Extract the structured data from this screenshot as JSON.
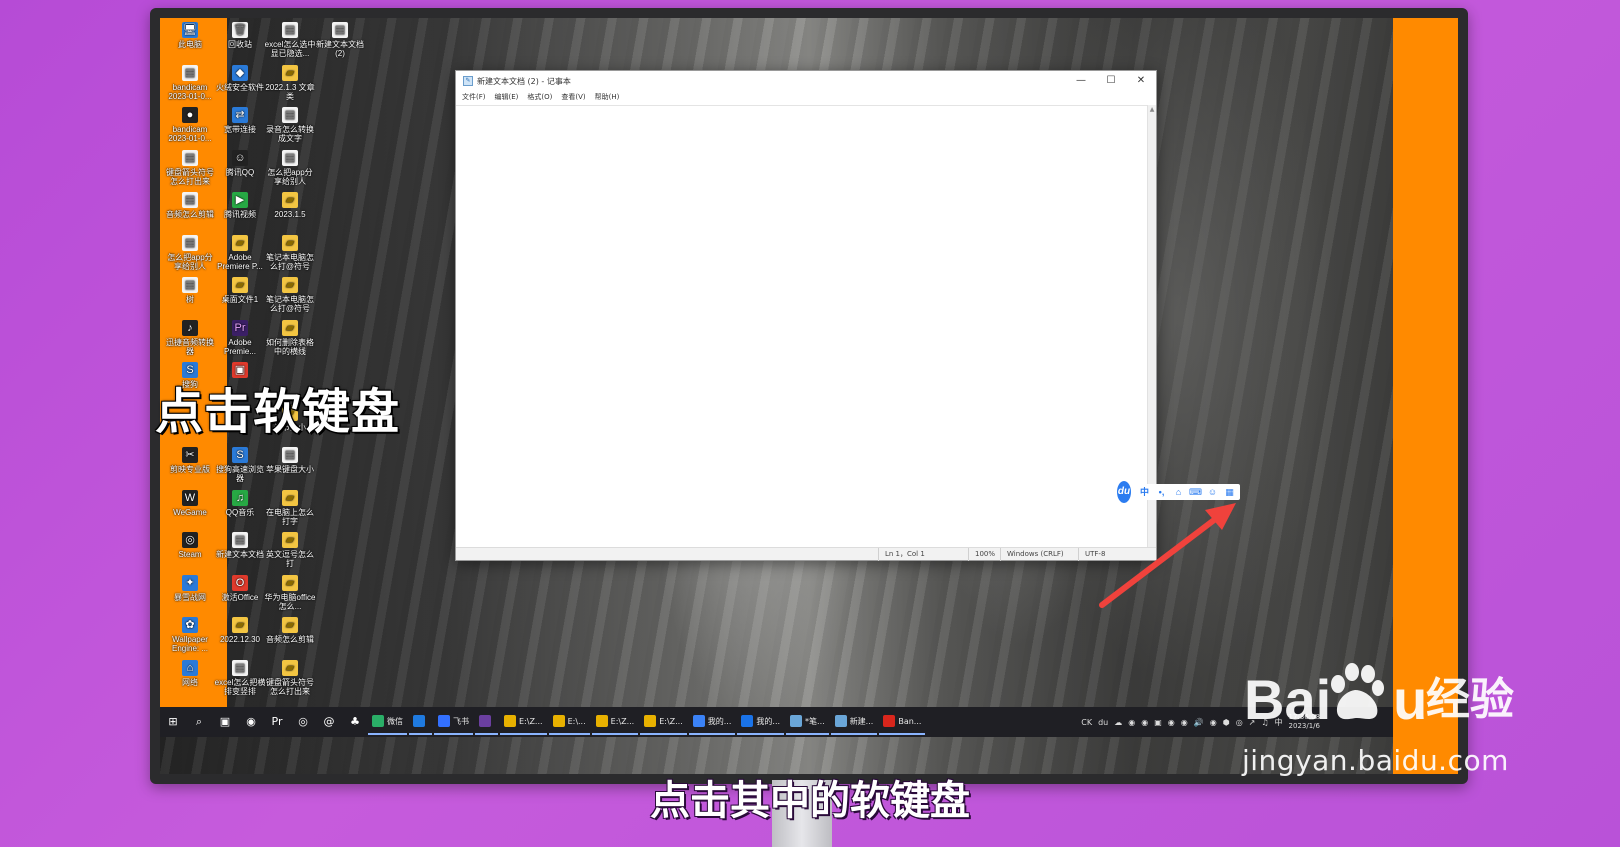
{
  "desktop": {
    "icons": [
      {
        "label": "此电脑",
        "kind": "app",
        "glyph": "🖥"
      },
      {
        "label": "回收站",
        "kind": "file",
        "glyph": "🗑"
      },
      {
        "label": "excel怎么选中显已隐选...",
        "kind": "file",
        "glyph": "▤"
      },
      {
        "label": "新建文本文档(2)",
        "kind": "file",
        "glyph": "▤"
      },
      {
        "label": "bandicam 2023-01-0...",
        "kind": "file",
        "glyph": "▤"
      },
      {
        "label": "火绒安全软件",
        "kind": "app",
        "glyph": "◆"
      },
      {
        "label": "2022.1.3 文章类",
        "kind": "folder",
        "glyph": "▰"
      },
      {
        "label": "bandicam 2023-01-0...",
        "kind": "dark",
        "glyph": "●"
      },
      {
        "label": "宽带连接",
        "kind": "app",
        "glyph": "⇄"
      },
      {
        "label": "录音怎么转换成文字",
        "kind": "file",
        "glyph": "▤"
      },
      {
        "label": "键盘箭头符号怎么打出来",
        "kind": "file",
        "glyph": "▤"
      },
      {
        "label": "腾讯QQ",
        "kind": "dark",
        "glyph": "☺"
      },
      {
        "label": "怎么把app分享给别人",
        "kind": "file",
        "glyph": "▤"
      },
      {
        "label": "音频怎么剪辑",
        "kind": "file",
        "glyph": "▤"
      },
      {
        "label": "腾讯视频",
        "kind": "green",
        "glyph": "▶"
      },
      {
        "label": "2023.1.5",
        "kind": "folder",
        "glyph": "▰"
      },
      {
        "label": "怎么把app分享给别人",
        "kind": "file",
        "glyph": "▤"
      },
      {
        "label": "Adobe Premiere P...",
        "kind": "folder",
        "glyph": "▰"
      },
      {
        "label": "笔记本电脑怎么打@符号",
        "kind": "folder",
        "glyph": "▰"
      },
      {
        "label": "树",
        "kind": "file",
        "glyph": "▤"
      },
      {
        "label": "桌面文件1",
        "kind": "folder",
        "glyph": "▰"
      },
      {
        "label": "笔记本电脑怎么打@符号",
        "kind": "folder",
        "glyph": "▰"
      },
      {
        "label": "迅捷音频转换器",
        "kind": "dark",
        "glyph": "♪"
      },
      {
        "label": "Adobe Premie...",
        "kind": "purple",
        "glyph": "Pr"
      },
      {
        "label": "如何删除表格中的横线",
        "kind": "folder",
        "glyph": "▰"
      },
      {
        "label": "搜狗",
        "kind": "app",
        "glyph": "S"
      },
      {
        "label": "",
        "kind": "red",
        "glyph": "▣"
      },
      {
        "label": "调节大小",
        "kind": "folder",
        "glyph": "▰"
      },
      {
        "label": "剪映专业版",
        "kind": "dark",
        "glyph": "✂"
      },
      {
        "label": "搜狗高速浏览器",
        "kind": "app",
        "glyph": "S"
      },
      {
        "label": "苹果键盘大小",
        "kind": "file",
        "glyph": "▤"
      },
      {
        "label": "WeGame",
        "kind": "dark",
        "glyph": "W"
      },
      {
        "label": "QQ音乐",
        "kind": "green",
        "glyph": "♫"
      },
      {
        "label": "在电脑上怎么打字",
        "kind": "folder",
        "glyph": "▰"
      },
      {
        "label": "Steam",
        "kind": "dark",
        "glyph": "◎"
      },
      {
        "label": "新建文本文档",
        "kind": "file",
        "glyph": "▤"
      },
      {
        "label": "英文逗号怎么打",
        "kind": "folder",
        "glyph": "▰"
      },
      {
        "label": "暴雪战网",
        "kind": "app",
        "glyph": "✦"
      },
      {
        "label": "激活Office",
        "kind": "red",
        "glyph": "O"
      },
      {
        "label": "华为电脑office怎么...",
        "kind": "folder",
        "glyph": "▰"
      },
      {
        "label": "Wallpaper Engine: ...",
        "kind": "app",
        "glyph": "✿"
      },
      {
        "label": "2022.12.30",
        "kind": "folder",
        "glyph": "▰"
      },
      {
        "label": "音频怎么剪辑",
        "kind": "folder",
        "glyph": "▰"
      },
      {
        "label": "网络",
        "kind": "app",
        "glyph": "⌂"
      },
      {
        "label": "excel怎么把横排变竖排",
        "kind": "file",
        "glyph": "▤"
      },
      {
        "label": "键盘箭头符号怎么打出来",
        "kind": "folder",
        "glyph": "▰"
      }
    ]
  },
  "notepad": {
    "title": "新建文本文档 (2) - 记事本",
    "menu": [
      "文件(F)",
      "编辑(E)",
      "格式(O)",
      "查看(V)",
      "帮助(H)"
    ],
    "content": "",
    "status": {
      "position": "Ln 1，Col 1",
      "zoom": "100%",
      "line_ending": "Windows (CRLF)",
      "encoding": "UTF-8"
    },
    "window_buttons": {
      "minimize": "—",
      "maximize": "☐",
      "close": "✕"
    }
  },
  "ime_toolbar": {
    "logo": "du",
    "buttons": [
      {
        "label": "中",
        "name": "ime-chinese-mode-button"
      },
      {
        "label": "•,",
        "name": "ime-punctuation-button"
      },
      {
        "label": "⌂",
        "name": "ime-toolbox-button"
      },
      {
        "label": "⌨",
        "name": "ime-soft-keyboard-button"
      },
      {
        "label": "☺",
        "name": "ime-user-button"
      },
      {
        "label": "▦",
        "name": "ime-menu-grid-button"
      }
    ]
  },
  "taskbar": {
    "pinned": [
      {
        "glyph": "⊞",
        "name": "start-icon"
      },
      {
        "glyph": "⌕",
        "name": "search-icon"
      },
      {
        "glyph": "▣",
        "name": "photos-icon"
      },
      {
        "glyph": "◉",
        "name": "app-green-icon"
      },
      {
        "glyph": "Pr",
        "name": "premiere-icon"
      },
      {
        "glyph": "◎",
        "name": "chrome-icon"
      },
      {
        "glyph": "@",
        "name": "mail-icon"
      },
      {
        "glyph": "♣",
        "name": "qq-icon"
      }
    ],
    "items": [
      {
        "label": "微信",
        "color": "#2aae67"
      },
      {
        "label": "",
        "color": "#1f7ae0"
      },
      {
        "label": "飞书",
        "color": "#3370ff"
      },
      {
        "label": "",
        "color": "#6b3fa0"
      },
      {
        "label": "E:\\Z...",
        "color": "#e8b100"
      },
      {
        "label": "E:\\...",
        "color": "#e8b100"
      },
      {
        "label": "E:\\Z...",
        "color": "#e8b100"
      },
      {
        "label": "E:\\Z...",
        "color": "#e8b100"
      },
      {
        "label": "我的...",
        "color": "#3b82f6"
      },
      {
        "label": "我的...",
        "color": "#1a73e8"
      },
      {
        "label": "*笔...",
        "color": "#6aa6d8"
      },
      {
        "label": "新建...",
        "color": "#6aa6d8"
      },
      {
        "label": "Ban...",
        "color": "#d9261c"
      }
    ],
    "tray": [
      "CK",
      "du",
      "☁",
      "◉",
      "◉",
      "▣",
      "◉",
      "◉",
      "🔊",
      "◉",
      "⬢",
      "◎",
      "↗",
      "♫",
      "中"
    ],
    "clock": {
      "time": "17:36:08",
      "date": "2023/1/6"
    }
  },
  "overlay": {
    "caption": "点击软键盘",
    "subtitle": "点击其中的软键盘",
    "arrow_color": "#f0423c"
  },
  "watermark": {
    "logo_text": "Bai du",
    "product": "经验",
    "url": "jingyan.baidu.com"
  }
}
